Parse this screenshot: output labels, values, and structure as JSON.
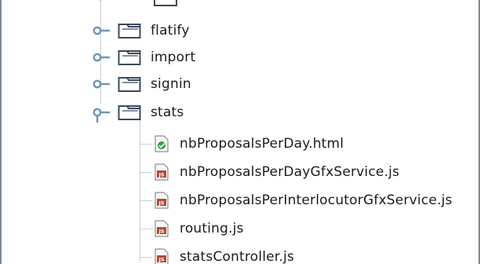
{
  "tree": {
    "folders": [
      {
        "label": "flatify",
        "icon": "folder-icon",
        "expanded": false
      },
      {
        "label": "import",
        "icon": "folder-icon",
        "expanded": false
      },
      {
        "label": "signin",
        "icon": "folder-icon",
        "expanded": false
      },
      {
        "label": "stats",
        "icon": "folder-icon",
        "expanded": true
      }
    ],
    "files": [
      {
        "label": "nbProposalsPerDay.html",
        "icon": "html-file-icon"
      },
      {
        "label": "nbProposalsPerDayGfxService.js",
        "icon": "js-file-icon"
      },
      {
        "label": "nbProposalsPerInterlocutorGfxService.js",
        "icon": "js-file-icon"
      },
      {
        "label": "routing.js",
        "icon": "js-file-icon"
      },
      {
        "label": "statsController.js",
        "icon": "js-file-icon"
      }
    ]
  },
  "colors": {
    "connector": "#9aa3b0",
    "toggle": "#6f93b8",
    "folder_fill": "#ffffff",
    "folder_stroke": "#3b4a5c",
    "js_badge": "#b24a3a",
    "html_badge": "#3f9b3f"
  }
}
